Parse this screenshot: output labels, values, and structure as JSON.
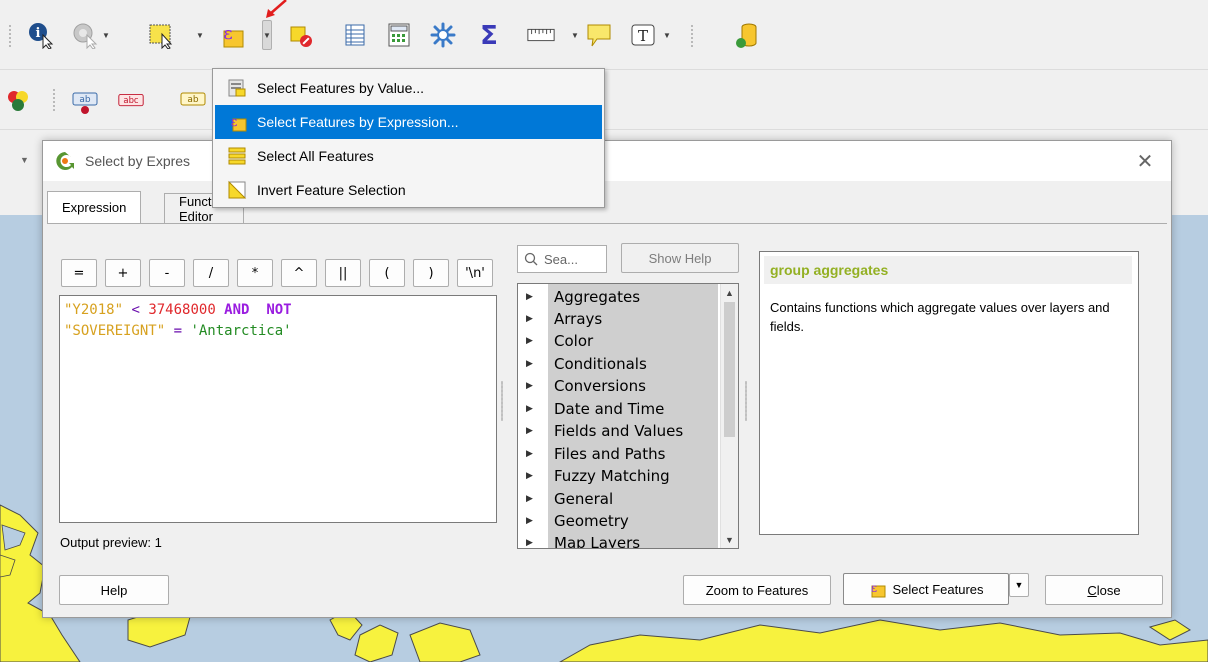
{
  "colors": {
    "accent": "#0078d7",
    "help_heading": "#93b023",
    "field_token": "#d7a11f",
    "number_token": "#e0282c",
    "keyword_token": "#9a1de0",
    "string_token": "#238b23",
    "map_water": "#b7cde1",
    "map_land": "#f7f23e"
  },
  "toolbar": {
    "row1_icons": [
      "identify-features-icon",
      "run-action-icon",
      "select-features-icon",
      "select-by-expression-icon",
      "deselect-icon",
      "attribute-table-icon",
      "field-calculator-icon",
      "processing-toolbox-icon",
      "statistics-sum-icon",
      "measure-icon",
      "map-tips-icon",
      "text-annotation-icon",
      "db-manager-icon"
    ],
    "row2_icons": [
      "layer-styling-icon",
      "label-tool-icon",
      "label-pin-icon",
      "label-tool-2-icon"
    ],
    "row2_labels": [
      "ab",
      "abc",
      "ab"
    ]
  },
  "menu": {
    "items": [
      {
        "label": "Select Features by Value...",
        "highlighted": false,
        "icon": "select-by-value-icon"
      },
      {
        "label": "Select Features by Expression...",
        "highlighted": true,
        "icon": "select-by-expression-icon"
      },
      {
        "label": "Select All Features",
        "highlighted": false,
        "icon": "select-all-icon"
      },
      {
        "label": "Invert Feature Selection",
        "highlighted": false,
        "icon": "invert-selection-icon"
      }
    ]
  },
  "dialog": {
    "title": "Select by Expres",
    "tabs": [
      {
        "label": "Expression",
        "active": true
      },
      {
        "label": "Function Editor",
        "active": false
      }
    ],
    "operators": [
      "=",
      "+",
      "-",
      "/",
      "*",
      "^",
      "||",
      "(",
      ")",
      "'\\n'"
    ],
    "expression": {
      "line1": [
        {
          "text": "\"Y2018\"",
          "kind": "field"
        },
        {
          "text": " < ",
          "kind": "op"
        },
        {
          "text": "37468000",
          "kind": "num"
        },
        {
          "text": " AND  ",
          "kind": "kw"
        },
        {
          "text": "NOT",
          "kind": "kw"
        }
      ],
      "line2": [
        {
          "text": "\"SOVEREIGNT\"",
          "kind": "field"
        },
        {
          "text": " = ",
          "kind": "op"
        },
        {
          "text": "'Antarctica'",
          "kind": "str"
        }
      ]
    },
    "output_preview": "Output preview:  1",
    "search_placeholder": "Sea...",
    "show_help_label": "Show Help",
    "functions": [
      "Aggregates",
      "Arrays",
      "Color",
      "Conditionals",
      "Conversions",
      "Date and Time",
      "Fields and Values",
      "Files and Paths",
      "Fuzzy Matching",
      "General",
      "Geometry",
      "Map Layers"
    ],
    "help": {
      "heading": "group aggregates",
      "body": "Contains functions which aggregate values over layers and fields."
    },
    "buttons": {
      "help": "Help",
      "zoom": "Zoom to Features",
      "select": "Select Features",
      "close": "Close"
    }
  }
}
